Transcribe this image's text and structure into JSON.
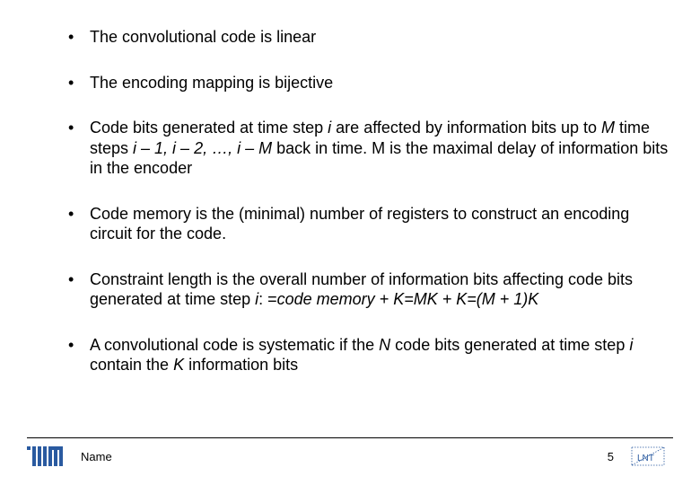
{
  "bullets": [
    {
      "pre": "The convolutional code is linear",
      "it1": "",
      "mid1": "",
      "it2": "",
      "mid2": "",
      "it3": "",
      "post": ""
    },
    {
      "pre": "The encoding mapping is bijective",
      "it1": "",
      "mid1": "",
      "it2": "",
      "mid2": "",
      "it3": "",
      "post": ""
    },
    {
      "pre": "Code bits generated at time step ",
      "it1": "i",
      "mid1": " are affected by information bits up to ",
      "it2": "M",
      "mid2": " time steps ",
      "it3": "i – 1, i – 2, …, i – M",
      "post": " back in time. M is the maximal delay of information bits in the encoder"
    },
    {
      "pre": "Code memory is the (minimal) number of registers to construct an encoding circuit for the code.",
      "it1": "",
      "mid1": "",
      "it2": "",
      "mid2": "",
      "it3": "",
      "post": ""
    },
    {
      "pre": "Constraint length is the overall number of information bits affecting code bits generated at time step ",
      "it1": "i",
      "mid1": ": =",
      "it2": "code memory + K=MK + K=(M + 1)K",
      "mid2": "",
      "it3": "",
      "post": ""
    },
    {
      "pre": "A convolutional code is systematic if the ",
      "it1": "N",
      "mid1": " code bits generated at time step ",
      "it2": "i",
      "mid2": " contain the ",
      "it3": "K",
      "post": " information bits"
    }
  ],
  "footer": {
    "name": "Name",
    "page": "5",
    "lnt": "LNT"
  },
  "colors": {
    "tum_blue": "#2a5aa0"
  }
}
